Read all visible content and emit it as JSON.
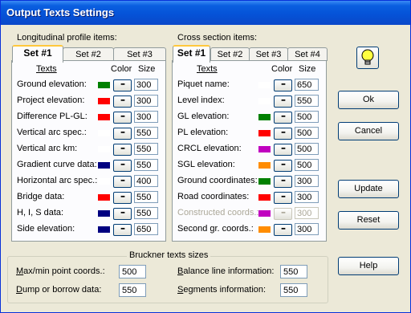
{
  "window": {
    "title": "Output Texts Settings"
  },
  "colors": {
    "green": "#008000",
    "red": "#ff0000",
    "white": "#ffffff",
    "navy": "#000080",
    "magenta": "#c000c0",
    "orange": "#ff8c00"
  },
  "longitudinal": {
    "group_label": "Longitudinal profile items:",
    "tabs": [
      "Set #1",
      "Set #2",
      "Set #3"
    ],
    "active_tab": "Set #1",
    "headers": {
      "texts": "Texts",
      "color": "Color",
      "size": "Size"
    },
    "color_button_label": "▪▪▪",
    "rows": [
      {
        "label": "Ground elevation:",
        "color": "#008000",
        "size": "300"
      },
      {
        "label": "Project elevation:",
        "color": "#ff0000",
        "size": "300"
      },
      {
        "label": "Difference PL-GL:",
        "color": "#ff0000",
        "size": "300"
      },
      {
        "label": "Vertical arc spec.:",
        "color": "#ffffff",
        "size": "550"
      },
      {
        "label": "Vertical arc km:",
        "color": "#ffffff",
        "size": "550"
      },
      {
        "label": "Gradient curve data:",
        "color": "#000080",
        "size": "550"
      },
      {
        "label": "Horizontal arc spec.:",
        "color": "#ffffff",
        "size": "400"
      },
      {
        "label": "Bridge data:",
        "color": "#ff0000",
        "size": "550"
      },
      {
        "label": "H, I, S data:",
        "color": "#000080",
        "size": "550"
      },
      {
        "label": "Side elevation:",
        "color": "#000080",
        "size": "650"
      }
    ]
  },
  "cross": {
    "group_label": "Cross section items:",
    "tabs": [
      "Set #1",
      "Set #2",
      "Set #3",
      "Set #4"
    ],
    "active_tab": "Set #1",
    "headers": {
      "texts": "Texts",
      "color": "Color",
      "size": "Size"
    },
    "rows": [
      {
        "label": "Piquet name:",
        "color": "#ffffff",
        "size": "650",
        "disabled": false
      },
      {
        "label": "Level index:",
        "color": "#ffffff",
        "size": "550",
        "disabled": false
      },
      {
        "label": "GL elevation:",
        "color": "#008000",
        "size": "500",
        "disabled": false
      },
      {
        "label": "PL elevation:",
        "color": "#ff0000",
        "size": "500",
        "disabled": false
      },
      {
        "label": "CRCL elevation:",
        "color": "#c000c0",
        "size": "500",
        "disabled": false
      },
      {
        "label": "SGL elevation:",
        "color": "#ff8c00",
        "size": "500",
        "disabled": false
      },
      {
        "label": "Ground coordinates:",
        "color": "#008000",
        "size": "300",
        "disabled": false
      },
      {
        "label": "Road coordinates:",
        "color": "#ff0000",
        "size": "300",
        "disabled": false
      },
      {
        "label": "Constructed coords.:",
        "color": "#c000c0",
        "size": "300",
        "disabled": true
      },
      {
        "label": "Second gr. coords.:",
        "color": "#ff8c00",
        "size": "300",
        "disabled": false
      }
    ]
  },
  "buttons": {
    "ok": "Ok",
    "cancel": "Cancel",
    "update": "Update",
    "reset": "Reset",
    "help": "Help"
  },
  "bruckner": {
    "title": "Bruckner texts sizes",
    "maxmin_label": "Max/min point coords.:",
    "maxmin_value": "500",
    "dump_label": "Dump or borrow data:",
    "dump_value": "550",
    "balance_label": "Balance line information:",
    "balance_value": "550",
    "segments_label": "Segments information:",
    "segments_value": "550"
  }
}
